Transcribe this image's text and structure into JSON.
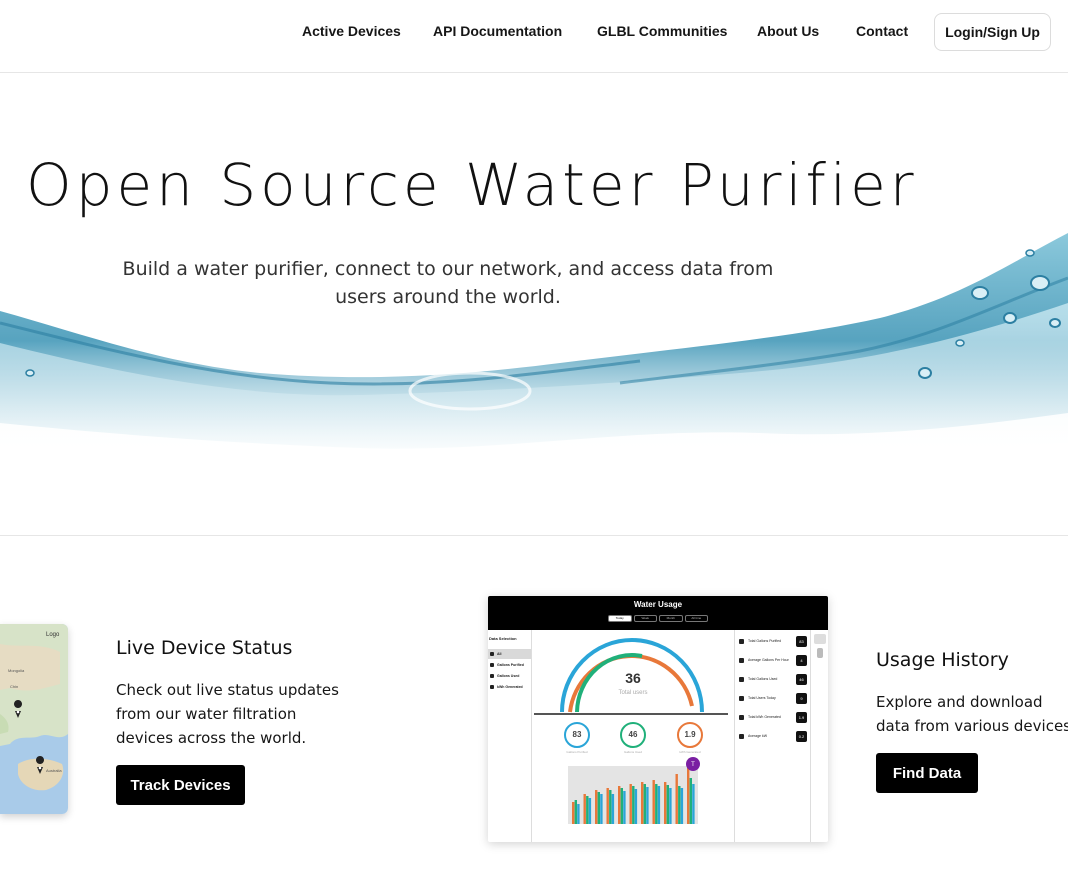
{
  "nav": {
    "links": [
      "Active Devices",
      "API Documentation",
      "GLBL Communities",
      "About Us",
      "Contact"
    ],
    "login_label": "Login/Sign Up"
  },
  "hero": {
    "title": "Open Source Water Purifier",
    "subtitle": "Build a water purifier, connect to our network, and access data from users around the world."
  },
  "features": {
    "live": {
      "title": "Live Device Status",
      "text": "Check out live status updates from our water filtration devices across the world.",
      "button": "Track Devices"
    },
    "history": {
      "title": "Usage History",
      "text": "Explore and download data from various devices.",
      "button": "Find Data"
    }
  },
  "map": {
    "labels": [
      "Logo",
      "Mongolia",
      "Chin",
      "Australia"
    ]
  },
  "dashboard": {
    "title": "Water Usage",
    "tabs": [
      "Today",
      "Week",
      "Month",
      "All time"
    ],
    "sidebar_heading": "Data Selection",
    "sidebar_items": [
      "All",
      "Gallons Purified",
      "Gallons Used",
      "kWh Generated"
    ],
    "gauge_value": "36",
    "gauge_label": "Total users",
    "rings": [
      {
        "value": "83",
        "label": "Gallons Purified",
        "color": "#2aa5d8"
      },
      {
        "value": "46",
        "label": "Gallons Used",
        "color": "#20b07a"
      },
      {
        "value": "1.9",
        "label": "kWh Generated",
        "color": "#e8783a"
      }
    ],
    "stats": [
      {
        "label": "Total Gallons Purified",
        "value": "83"
      },
      {
        "label": "Average Gallons Per Hour",
        "value": "4"
      },
      {
        "label": "Total Gallons Used",
        "value": "46"
      },
      {
        "label": "Total Users Today",
        "value": "9"
      },
      {
        "label": "Total kWh Generated",
        "value": "1.9"
      },
      {
        "label": "Average kW",
        "value": "0.2"
      }
    ],
    "avatar_initial": "T",
    "colors": {
      "blue": "#2aa5d8",
      "green": "#20b07a",
      "orange": "#e8783a"
    }
  }
}
